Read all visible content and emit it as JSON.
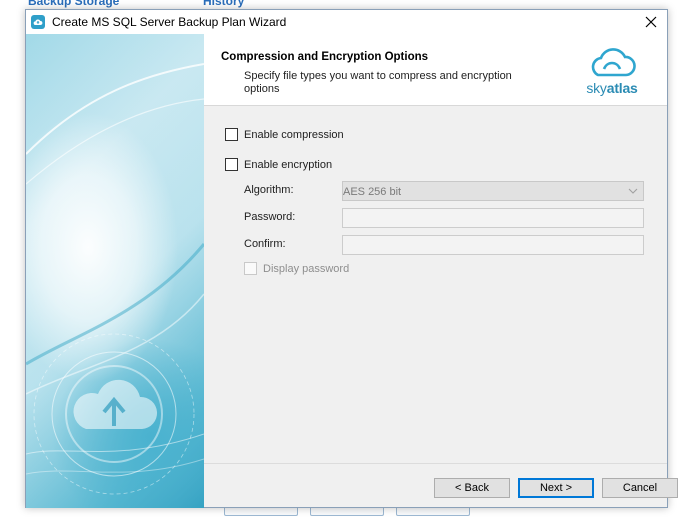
{
  "background": {
    "tabs": [
      "Backup Storage",
      "History"
    ]
  },
  "dialog": {
    "title": "Create MS SQL Server Backup Plan Wizard",
    "icons": {
      "app": "cloud-icon",
      "close": "close-icon"
    }
  },
  "header": {
    "title": "Compression and Encryption Options",
    "subtitle": "Specify file types you want to compress and encryption options",
    "logo": {
      "prefix": "sky",
      "suffix": "atlas",
      "color": "#2a8bb3"
    }
  },
  "options": {
    "compression": {
      "label": "Enable compression",
      "checked": false
    },
    "encryption": {
      "label": "Enable encryption",
      "checked": false
    }
  },
  "encryption_settings": {
    "algorithm_label": "Algorithm:",
    "algorithm_value": "AES 256 bit",
    "password_label": "Password:",
    "password_value": "",
    "confirm_label": "Confirm:",
    "confirm_value": "",
    "display_password_label": "Display password"
  },
  "buttons": {
    "back": "< Back",
    "next": "Next >",
    "cancel": "Cancel"
  },
  "colors": {
    "accent": "#0078d7",
    "brand": "#2a8bb3",
    "panel": "#f0f0f0"
  }
}
